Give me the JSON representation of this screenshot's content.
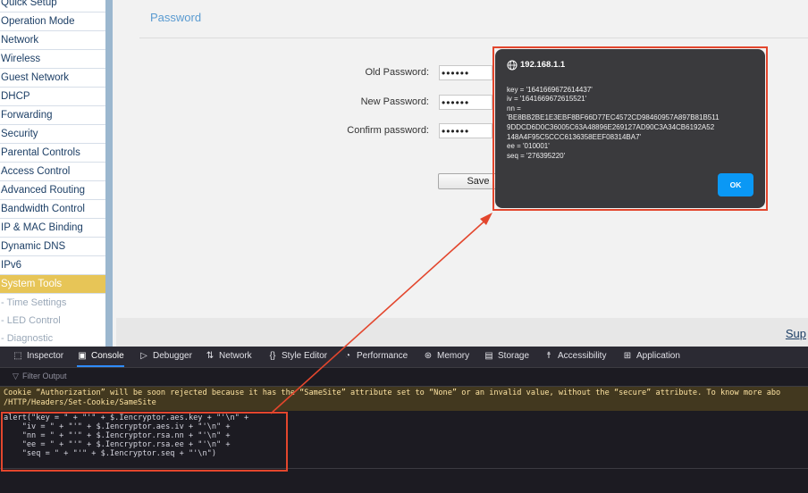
{
  "sidebar": {
    "items": [
      {
        "label": "Quick Setup"
      },
      {
        "label": "Operation Mode"
      },
      {
        "label": "Network"
      },
      {
        "label": "Wireless"
      },
      {
        "label": "Guest Network"
      },
      {
        "label": "DHCP"
      },
      {
        "label": "Forwarding"
      },
      {
        "label": "Security"
      },
      {
        "label": "Parental Controls"
      },
      {
        "label": "Access Control"
      },
      {
        "label": "Advanced Routing"
      },
      {
        "label": "Bandwidth Control"
      },
      {
        "label": "IP & MAC Binding"
      },
      {
        "label": "Dynamic DNS"
      },
      {
        "label": "IPv6"
      },
      {
        "label": "System Tools"
      }
    ],
    "subitems": [
      {
        "label": "- Time Settings"
      },
      {
        "label": "- LED Control"
      },
      {
        "label": "- Diagnostic"
      }
    ]
  },
  "main": {
    "section_title": "Password",
    "old_password_label": "Old Password:",
    "old_password_value": "••••••",
    "new_password_label": "New Password:",
    "new_password_value": "••••••",
    "confirm_password_label": "Confirm password:",
    "confirm_password_value": "••••••",
    "save_label": "Save",
    "support_link": "Sup"
  },
  "dialog": {
    "host": "192.168.1.1",
    "lines": [
      "key = '1641669672614437'",
      "iv = '1641669672615521'",
      "nn =",
      "'BE8BB2BE1E3EBF8BF66D77EC4572CD98460957A897B81B511",
      "9DDCD6D0C36005C63A48896E269127AD90C3A34CB6192A52",
      "148A4F95C5CCC6136358EEF08314BA7'",
      "ee = '010001'",
      "seq = '276395220'"
    ],
    "ok_label": "OK"
  },
  "devtools": {
    "tabs": [
      {
        "label": "Inspector",
        "icon": "inspector-icon"
      },
      {
        "label": "Console",
        "icon": "console-icon"
      },
      {
        "label": "Debugger",
        "icon": "debugger-icon"
      },
      {
        "label": "Network",
        "icon": "network-icon"
      },
      {
        "label": "Style Editor",
        "icon": "style-editor-icon"
      },
      {
        "label": "Performance",
        "icon": "performance-icon"
      },
      {
        "label": "Memory",
        "icon": "memory-icon"
      },
      {
        "label": "Storage",
        "icon": "storage-icon"
      },
      {
        "label": "Accessibility",
        "icon": "accessibility-icon"
      },
      {
        "label": "Application",
        "icon": "application-icon"
      }
    ],
    "filter_placeholder": "Filter Output",
    "warning_line1": "Cookie “Authorization” will be soon rejected because it has the “SameSite” attribute set to “None” or an invalid value, without the “secure” attribute. To know more abo",
    "warning_line2": "/HTTP/Headers/Set-Cookie/SameSite",
    "code_lines": [
      "alert(\"key = \" + \"'\" + $.Iencryptor.aes.key + \"'\\n\" +",
      "    \"iv = \" + \"'\" + $.Iencryptor.aes.iv + \"'\\n\" +",
      "    \"nn = \" + \"'\" + $.Iencryptor.rsa.nn + \"'\\n\" +",
      "    \"ee = \" + \"'\" + $.Iencryptor.rsa.ee + \"'\\n\" +",
      "    \"seq = \" + \"'\" + $.Iencryptor.seq + \"'\\n\")"
    ]
  },
  "colors": {
    "sidebar_active": "#e7c557",
    "sidebar_text": "#1d3f66",
    "title_blue": "#5a9bd1",
    "annotation_red": "#e3462d",
    "ok_blue": "#0a98f5",
    "devtools_bg": "#1c1b22",
    "warning_bg": "#42381f"
  }
}
